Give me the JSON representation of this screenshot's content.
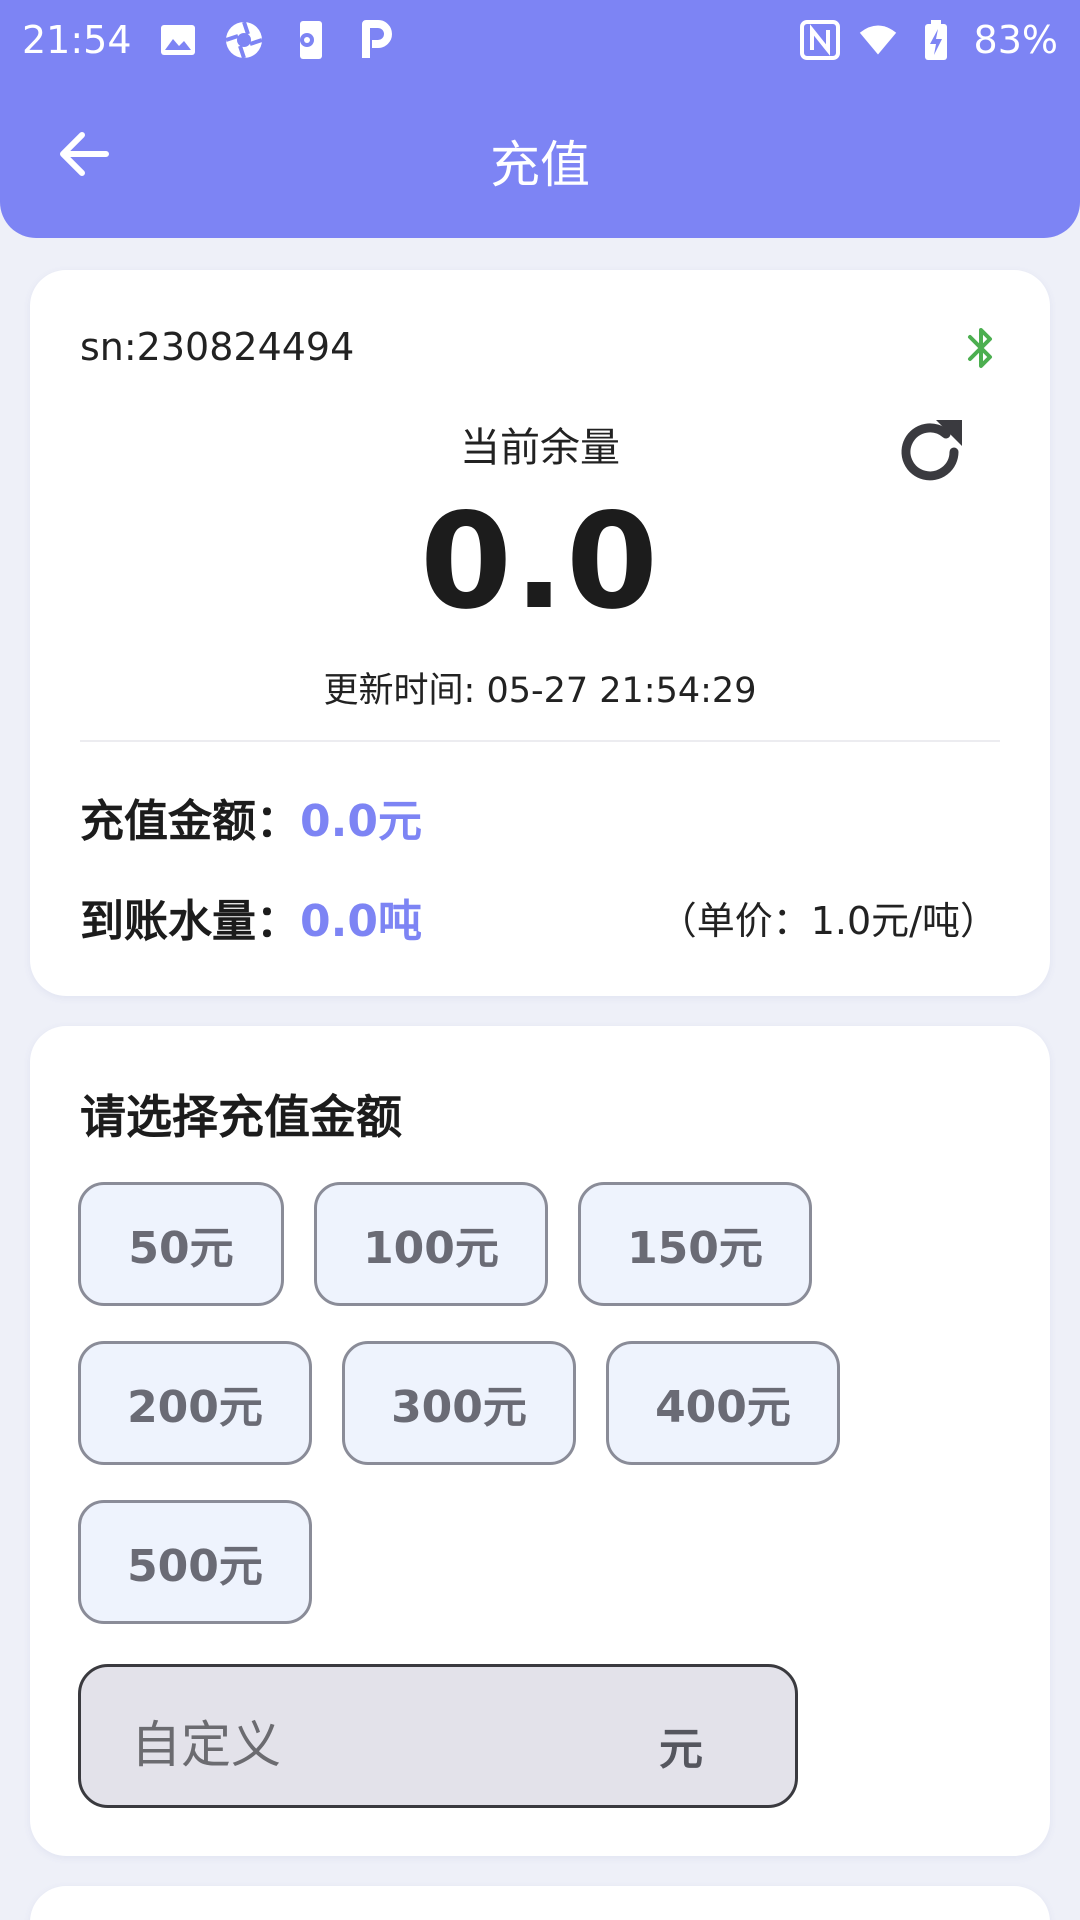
{
  "status_bar": {
    "time": "21:54",
    "battery": "83%",
    "left_icons": [
      "image-icon",
      "aperture-icon",
      "phone-settings-icon",
      "p-icon"
    ],
    "right_icons": [
      "nfc-icon",
      "wifi-icon",
      "battery-charging-icon"
    ]
  },
  "header": {
    "title": "充值",
    "back_icon": "arrow-left-icon",
    "color": "#7d84f4"
  },
  "device": {
    "sn": "sn:230824494",
    "bluetooth_color": "#4caf50",
    "balance_label": "当前余量",
    "balance_value": "0.0",
    "update_time": "更新时间: 05-27 21:54:29"
  },
  "summary": {
    "amount_label": "充值金额：",
    "amount_value": "0.0元",
    "water_label": "到账水量：",
    "water_value": "0.0吨",
    "unit_price": "（单价：1.0元/吨）"
  },
  "recharge": {
    "section_title": "请选择充值金额",
    "options": [
      "50元",
      "100元",
      "150元",
      "200元",
      "300元",
      "400元",
      "500元"
    ],
    "custom_placeholder": "自定义",
    "custom_unit": "元"
  }
}
